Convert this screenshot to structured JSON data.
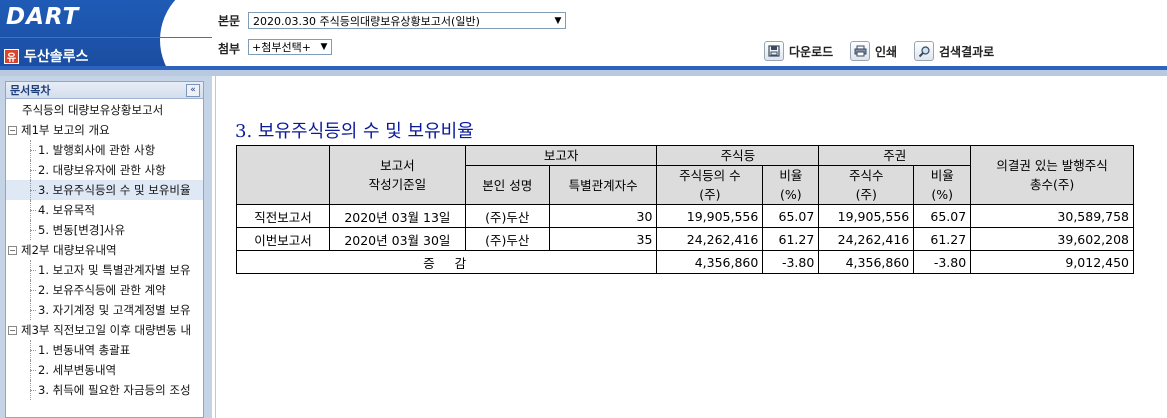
{
  "header": {
    "logo_text": "DART",
    "company_icon": "유",
    "company_name": "두산솔루스",
    "main_label": "본문",
    "main_select_value": "2020.03.30  주식등의대량보유상황보고서(일반)",
    "attach_label": "첨부",
    "attach_select_value": "+첨부선택+",
    "buttons": {
      "download": "다운로드",
      "print": "인쇄",
      "search_results": "검색결과로"
    }
  },
  "sidebar": {
    "title": "문서목차",
    "collapse_glyph": "«",
    "items": [
      {
        "label": "주식등의 대량보유상황보고서",
        "level": 0
      },
      {
        "label": "제1부 보고의 개요",
        "level": 1,
        "toggle": "−"
      },
      {
        "label": "1. 발행회사에 관한 사항",
        "level": 2
      },
      {
        "label": "2. 대량보유자에 관한 사항",
        "level": 2
      },
      {
        "label": "3. 보유주식등의 수 및 보유비율",
        "level": 2,
        "active": true
      },
      {
        "label": "4. 보유목적",
        "level": 2
      },
      {
        "label": "5. 변동[변경]사유",
        "level": 2
      },
      {
        "label": "제2부 대량보유내역",
        "level": 1,
        "toggle": "−"
      },
      {
        "label": "1. 보고자 및 특별관계자별 보유",
        "level": 2
      },
      {
        "label": "2. 보유주식등에 관한 계약",
        "level": 2
      },
      {
        "label": "3. 자기계정 및 고객계정별 보유",
        "level": 2
      },
      {
        "label": "제3부 직전보고일 이후 대량변동 내",
        "level": 1,
        "toggle": "−"
      },
      {
        "label": "1. 변동내역 총괄표",
        "level": 2
      },
      {
        "label": "2. 세부변동내역",
        "level": 2
      },
      {
        "label": "3. 취득에 필요한 자금등의 조성",
        "level": 2
      }
    ]
  },
  "content": {
    "section_title": "3. 보유주식등의 수 및 보유비율",
    "table": {
      "headers": {
        "report_date": "보고서\n작성기준일",
        "reporter": "보고자",
        "principal_name": "본인 성명",
        "related_count": "특별관계자수",
        "shares_group": "주식등",
        "shares_count": "주식등의 수\n(주)",
        "shares_ratio": "비율\n(%)",
        "stock_group": "주권",
        "stock_count": "주식수\n(주)",
        "stock_ratio": "비율\n(%)",
        "total_voting": "의결권 있는 발행주식\n총수(주)"
      },
      "rows": [
        {
          "label": "직전보고서",
          "date": "2020년 03월 13일",
          "name": "(주)두산",
          "related": "30",
          "shares": "19,905,556",
          "shares_ratio": "65.07",
          "stock": "19,905,556",
          "stock_ratio": "65.07",
          "total": "30,589,758"
        },
        {
          "label": "이번보고서",
          "date": "2020년 03월 30일",
          "name": "(주)두산",
          "related": "35",
          "shares": "24,262,416",
          "shares_ratio": "61.27",
          "stock": "24,262,416",
          "stock_ratio": "61.27",
          "total": "39,602,208"
        }
      ],
      "change_row": {
        "label": "증  감",
        "shares": "4,356,860",
        "shares_ratio": "-3.80",
        "stock": "4,356,860",
        "stock_ratio": "-3.80",
        "total": "9,012,450"
      }
    }
  },
  "colors": {
    "header_blue": "#1f5bb6",
    "title_blue": "#0a1a9a",
    "table_header_gray": "#dcdcdc",
    "sidebar_bg": "#c5d3e6"
  },
  "icons": {
    "download": "save-icon",
    "print": "printer-icon",
    "search": "search-icon"
  }
}
